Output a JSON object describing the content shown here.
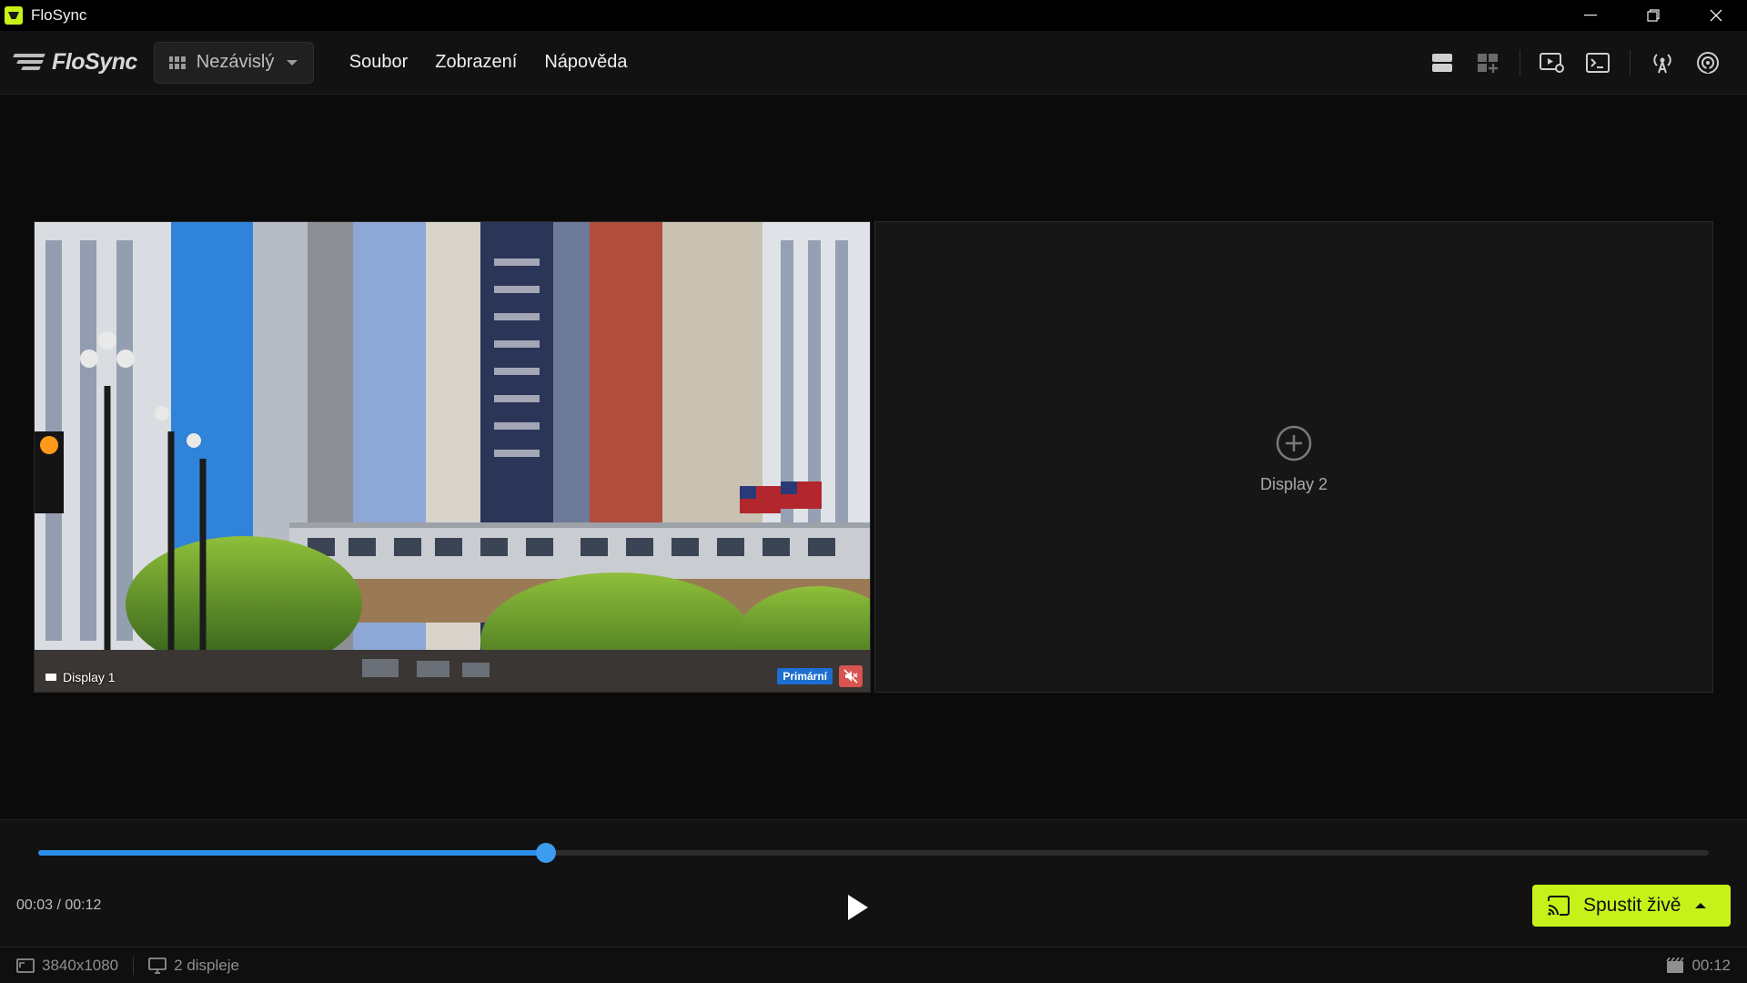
{
  "window": {
    "title": "FloSync",
    "controls": [
      "minimize",
      "restore",
      "close"
    ]
  },
  "menubar": {
    "logo_text": "FloSync",
    "mode_select": {
      "value": "Nezávislý"
    },
    "menu": [
      "Soubor",
      "Zobrazení",
      "Nápověda"
    ],
    "toolbar_icons": [
      "layout-rows-icon",
      "layout-grid-add-icon",
      "video-settings-icon",
      "terminal-icon",
      "broadcast-icon",
      "signal-icon"
    ]
  },
  "displays": {
    "display1": {
      "label": "Display 1",
      "badge": "Primární",
      "muted": true
    },
    "display2": {
      "label": "Display 2"
    }
  },
  "playback": {
    "time": "00:03 / 00:12",
    "progress_fraction": 0.304,
    "live_button": "Spustit živě"
  },
  "statusbar": {
    "resolution": "3840x1080",
    "displays": "2 displeje",
    "duration": "00:12"
  },
  "colors": {
    "accent": "#c6f21a",
    "progress": "#2a8fe9",
    "primary_badge": "#1c6fd0",
    "mute": "#d9534f"
  }
}
